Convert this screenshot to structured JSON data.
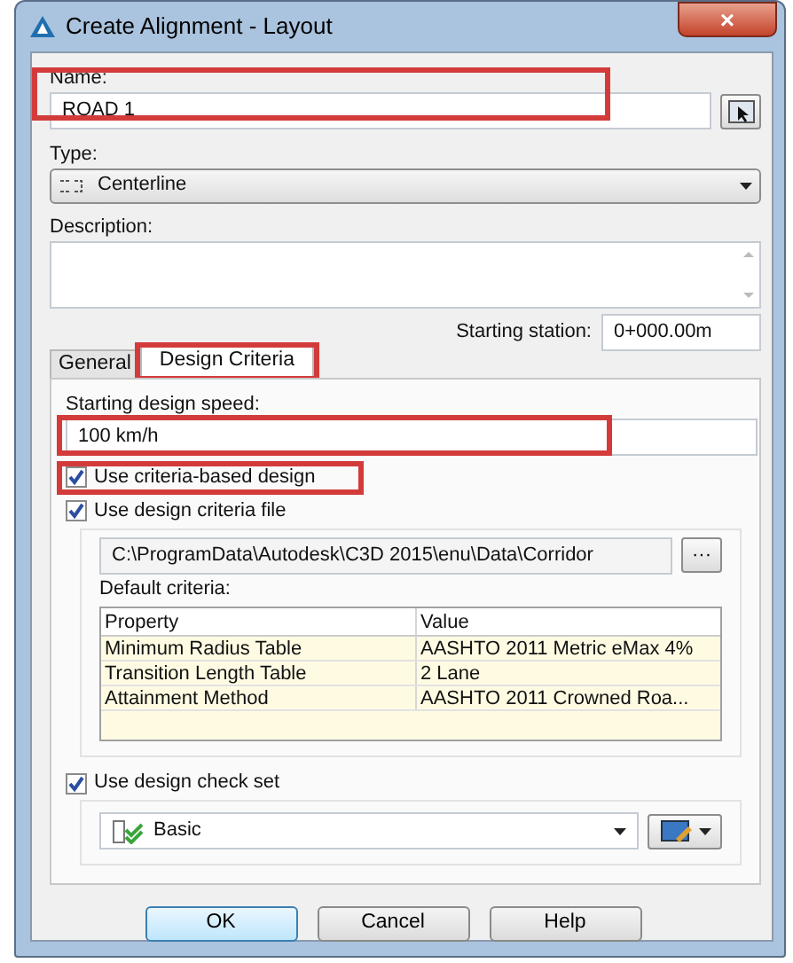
{
  "window": {
    "title": "Create Alignment - Layout",
    "close": "×"
  },
  "name": {
    "label": "Name:",
    "value": "ROAD 1",
    "highlighted": true
  },
  "type": {
    "label": "Type:",
    "value": "Centerline"
  },
  "description": {
    "label": "Description:"
  },
  "starting_station": {
    "label": "Starting station:",
    "value": "0+000.00m"
  },
  "tabs": [
    {
      "label": "General",
      "selected": false,
      "highlighted": false
    },
    {
      "label": "Design Criteria",
      "selected": true,
      "highlighted": true
    }
  ],
  "design_speed": {
    "label": "Starting design speed:",
    "value": "100 km/h",
    "highlighted": true
  },
  "use_criteria": {
    "label": "Use criteria-based design",
    "checked": true,
    "highlighted": true
  },
  "use_file": {
    "label": "Use design criteria file",
    "checked": true,
    "path": "C:\\ProgramData\\Autodesk\\C3D 2015\\enu\\Data\\Corridor",
    "browse": "···"
  },
  "default_criteria": {
    "label": "Default criteria:",
    "columns": [
      "Property",
      "Value"
    ],
    "rows": [
      [
        "Minimum Radius Table",
        "AASHTO 2011 Metric eMax 4%"
      ],
      [
        "Transition Length Table",
        "2 Lane"
      ],
      [
        "Attainment Method",
        "AASHTO 2011 Crowned Roa..."
      ]
    ]
  },
  "check_set": {
    "label": "Use design check set",
    "checked": true,
    "value": "Basic"
  },
  "buttons": [
    {
      "label": "OK",
      "default": true
    },
    {
      "label": "Cancel",
      "default": false
    },
    {
      "label": "Help",
      "default": false
    }
  ]
}
